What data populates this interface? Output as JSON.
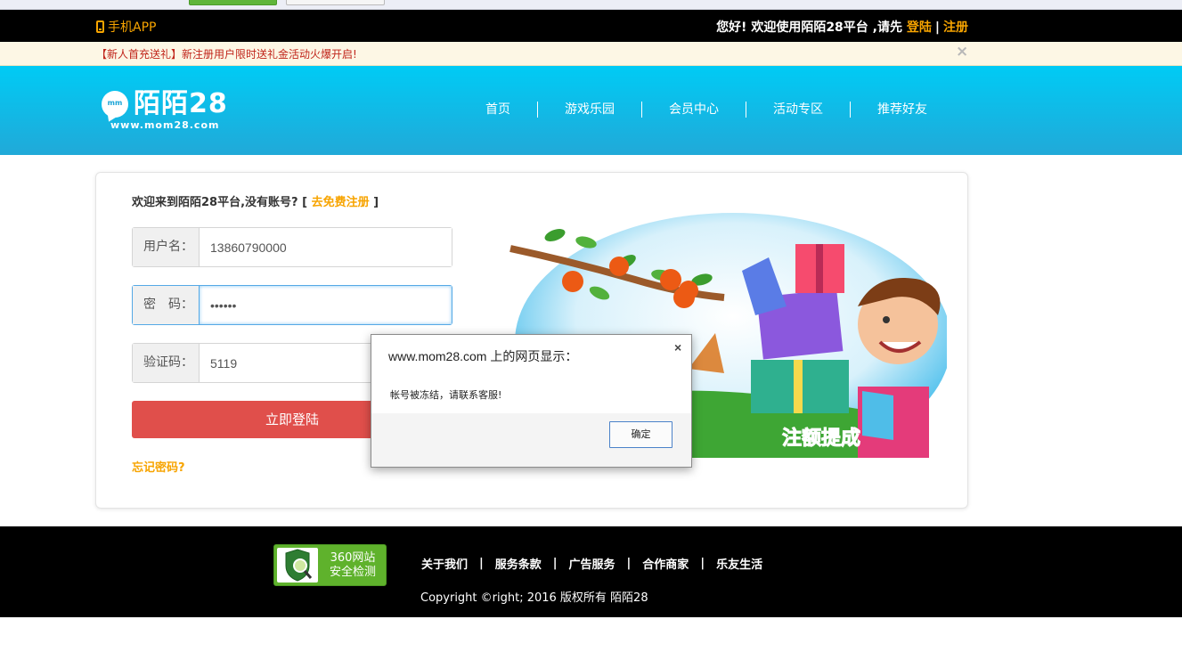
{
  "topbar": {
    "app_label": "手机APP",
    "welcome_text": "您好! 欢迎使用陌陌28平台 ,请先",
    "login_link": "登陆",
    "separator": "|",
    "register_link": "注册"
  },
  "notice": {
    "text": "【新人首充送礼】新注册用户限时送礼金活动火爆开启!",
    "close_glyph": "×"
  },
  "header": {
    "logo_text": "陌陌28",
    "logo_url": "www.mom28.com",
    "logo_badge": "mm",
    "nav": [
      "首页",
      "游戏乐园",
      "会员中心",
      "活动专区",
      "推荐好友"
    ]
  },
  "login": {
    "intro": "欢迎来到陌陌28平台,没有账号? [",
    "register_link": "去免费注册",
    "intro_close": "]",
    "username_label": "用户名：",
    "username_value": "13860790000",
    "password_label": "密　码：",
    "password_value": "••••••",
    "captcha_label": "验证码：",
    "captcha_value": "5119",
    "submit_label": "立即登陆",
    "forgot_label": "忘记密码?"
  },
  "promo": {
    "banner_text": "注额提成"
  },
  "dialog": {
    "title": "www.mom28.com 上的网页显示：",
    "close_glyph": "×",
    "message": "帐号被冻结，请联系客服!",
    "ok_label": "确定"
  },
  "footer": {
    "badge_line1": "360网站",
    "badge_line2": "安全检测",
    "links": [
      "关于我们",
      "服务条款",
      "广告服务",
      "合作商家",
      "乐友生活"
    ],
    "link_separator": "|",
    "copyright": "Copyright ©right; 2016 版权所有 陌陌28"
  },
  "colors": {
    "accent": "#f7a400",
    "header_blue": "#00cbf5",
    "login_red": "#e04f4b",
    "notice_red": "#c0241a"
  }
}
